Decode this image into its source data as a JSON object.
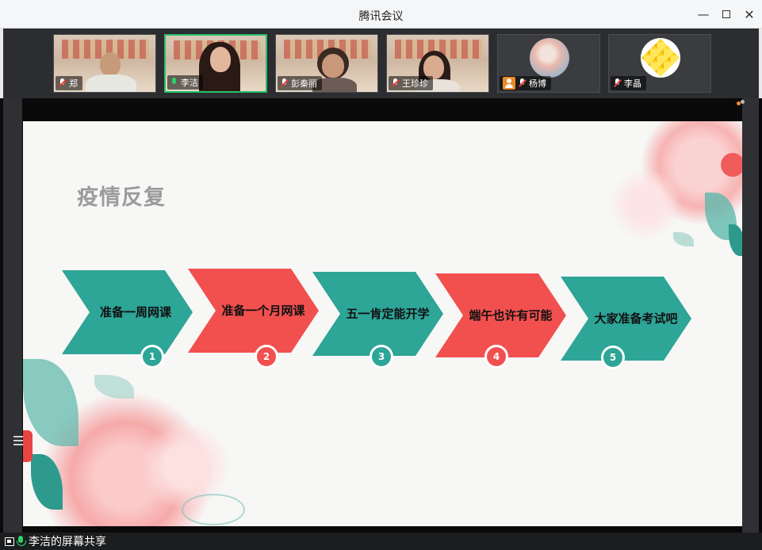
{
  "window": {
    "title": "腾讯会议"
  },
  "participants": [
    {
      "name": "郑",
      "mic": "muted",
      "type": "video"
    },
    {
      "name": "李洁",
      "mic": "on",
      "type": "video",
      "active": true
    },
    {
      "name": "彭秦丽",
      "mic": "muted",
      "type": "video"
    },
    {
      "name": "王珍珍",
      "mic": "muted",
      "type": "video"
    },
    {
      "name": "杨博",
      "mic": "muted",
      "type": "avatar",
      "avatar_icon": "hand-photo-avatar"
    },
    {
      "name": "李晶",
      "mic": "muted",
      "type": "avatar",
      "avatar_icon": "yellow-cubes-avatar"
    }
  ],
  "slide": {
    "title": "疫情反复",
    "steps": [
      {
        "label": "准备一周网课",
        "number": "1",
        "color": "#2da597"
      },
      {
        "label": "准备一个月网课",
        "number": "2",
        "color": "#f2504f"
      },
      {
        "label": "五一肯定能开学",
        "number": "3",
        "color": "#2da597"
      },
      {
        "label": "端午也许有可能",
        "number": "4",
        "color": "#f2504f"
      },
      {
        "label": "大家准备考试吧",
        "number": "5",
        "color": "#2da597"
      }
    ]
  },
  "status": {
    "share_text": "李洁的屏幕共享"
  },
  "colors": {
    "accent_green": "#27c06b",
    "teal": "#2da597",
    "coral": "#f2504f"
  }
}
